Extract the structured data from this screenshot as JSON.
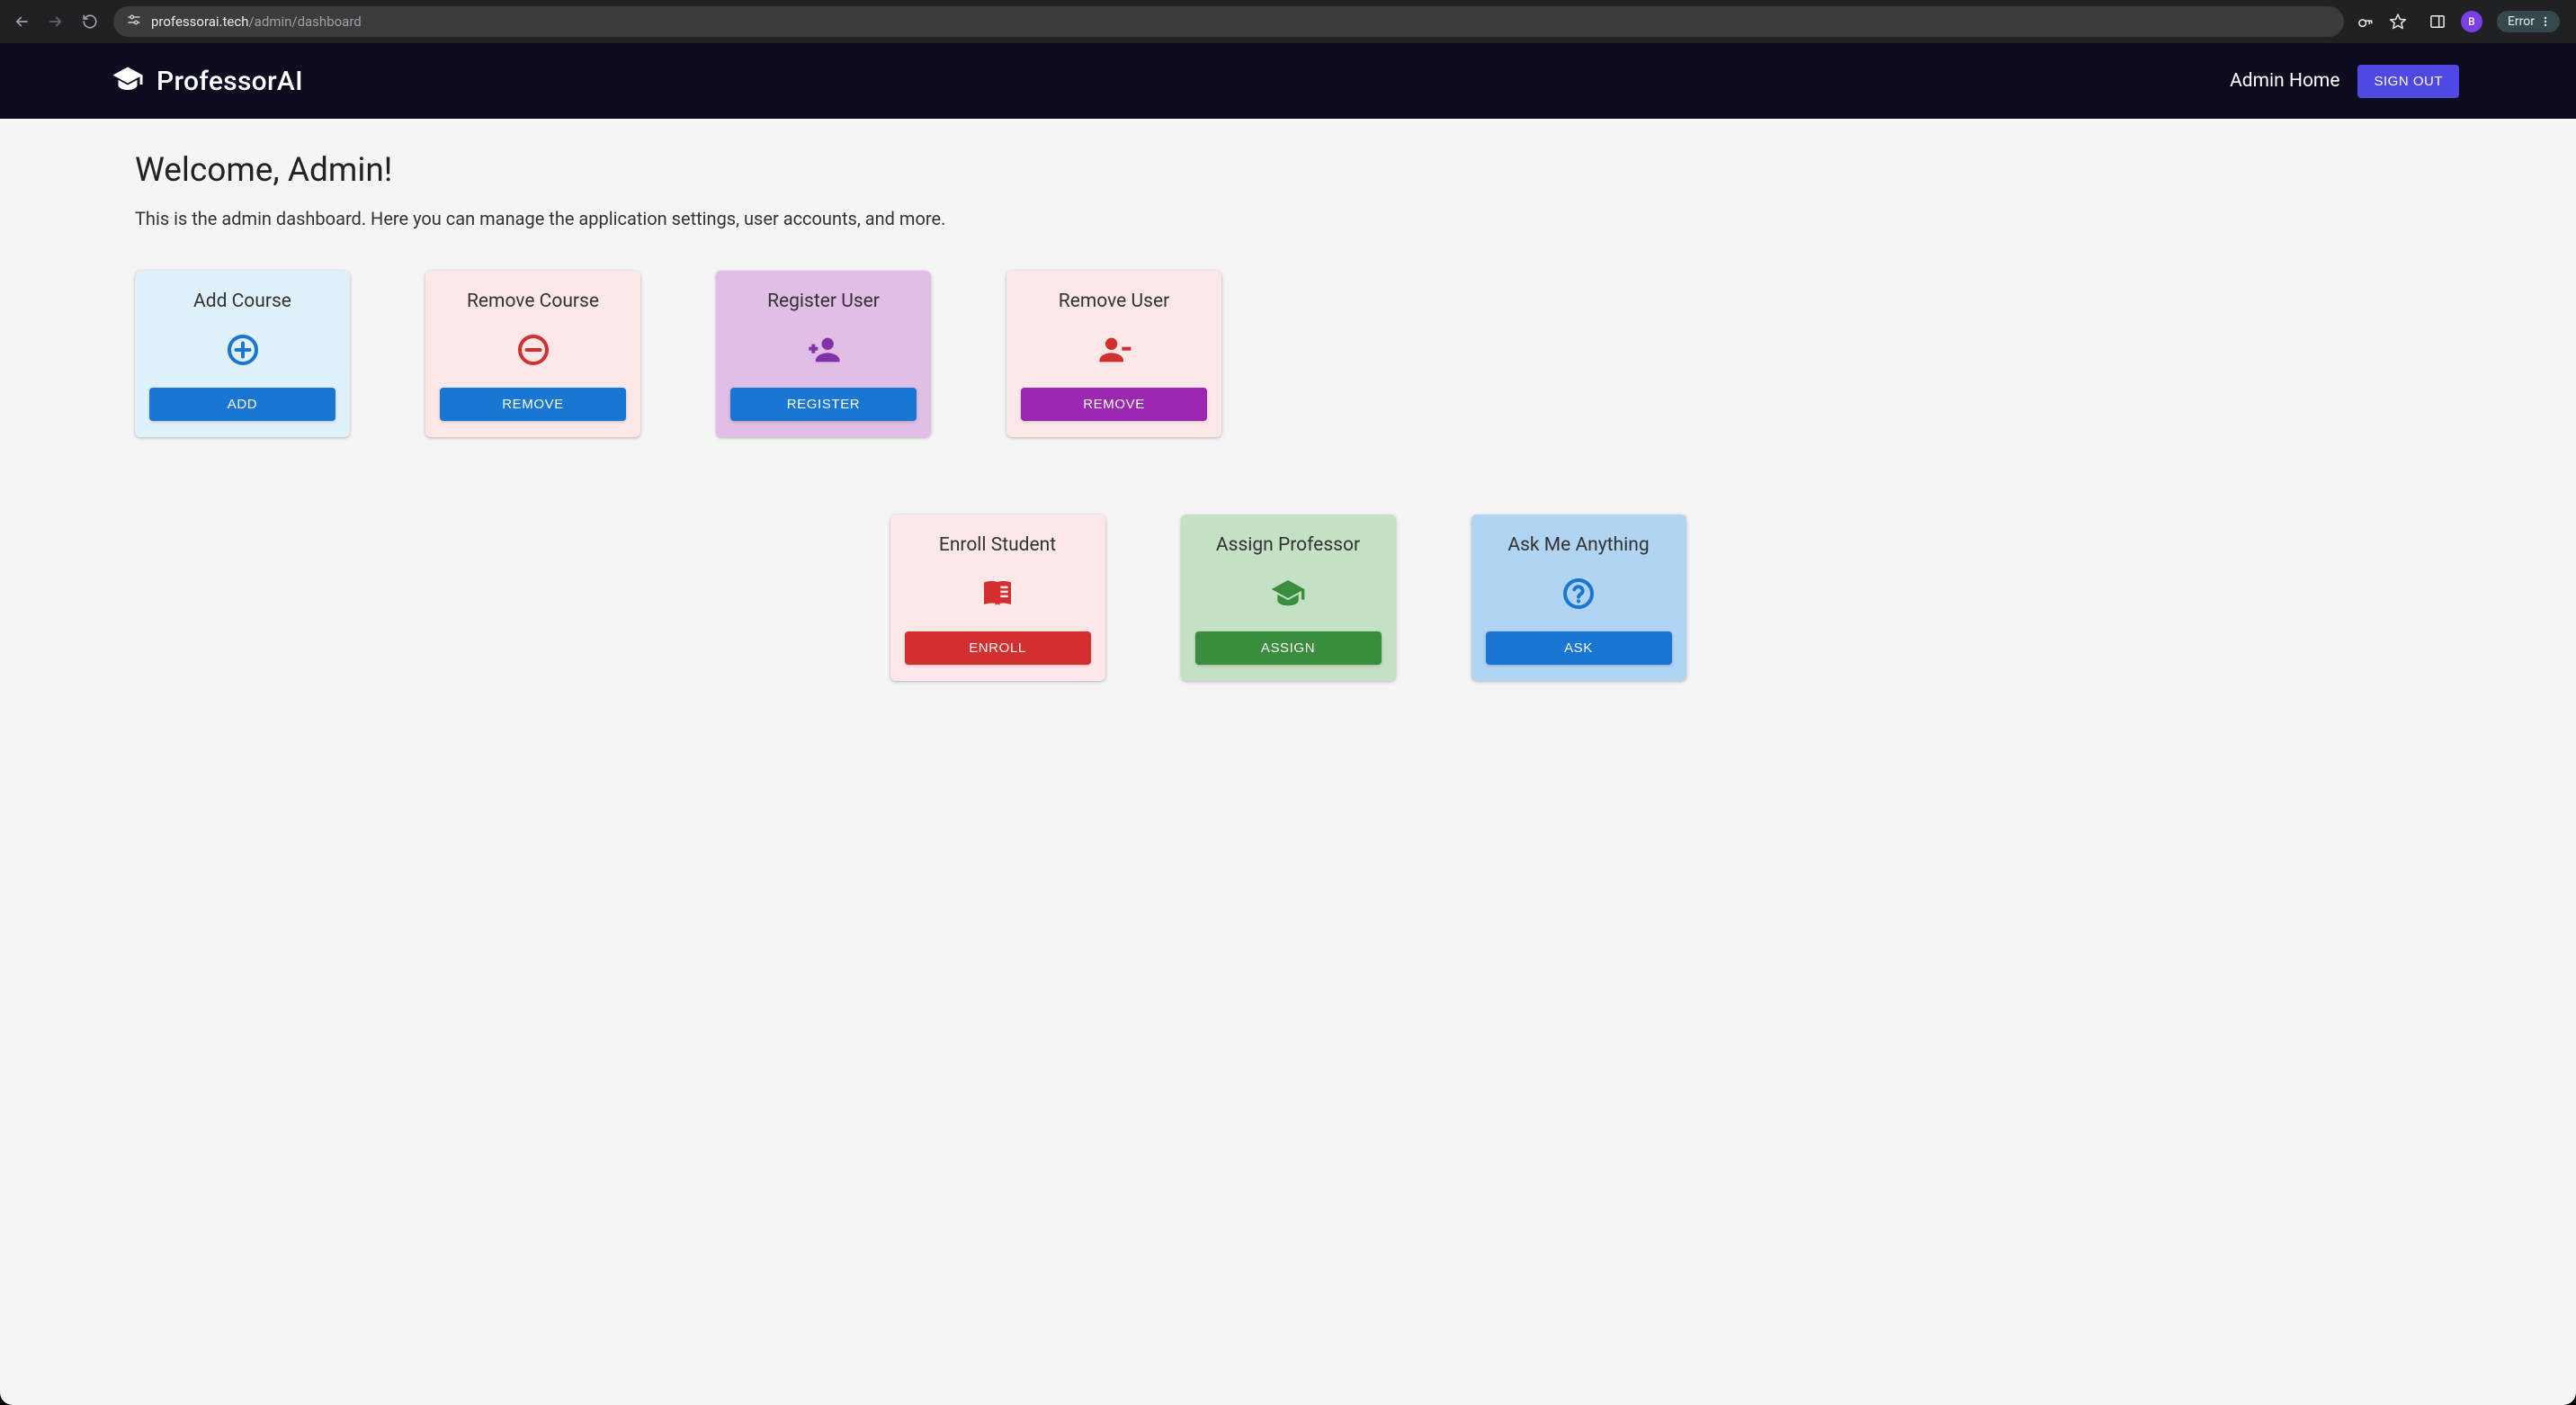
{
  "browser": {
    "url_host": "professorai.tech",
    "url_path": "/admin/dashboard",
    "avatar_letter": "B",
    "error_label": "Error"
  },
  "header": {
    "brand": "ProfessorAI",
    "admin_home": "Admin Home",
    "sign_out": "SIGN OUT"
  },
  "main": {
    "welcome": "Welcome, Admin!",
    "subtitle": "This is the admin dashboard. Here you can manage the application settings, user accounts, and more."
  },
  "cards": {
    "add_course": {
      "title": "Add Course",
      "button": "ADD"
    },
    "remove_course": {
      "title": "Remove Course",
      "button": "REMOVE"
    },
    "register_user": {
      "title": "Register User",
      "button": "REGISTER"
    },
    "remove_user": {
      "title": "Remove User",
      "button": "REMOVE"
    },
    "enroll_student": {
      "title": "Enroll Student",
      "button": "ENROLL"
    },
    "assign_professor": {
      "title": "Assign Professor",
      "button": "ASSIGN"
    },
    "ask_me_anything": {
      "title": "Ask Me Anything",
      "button": "ASK"
    }
  }
}
